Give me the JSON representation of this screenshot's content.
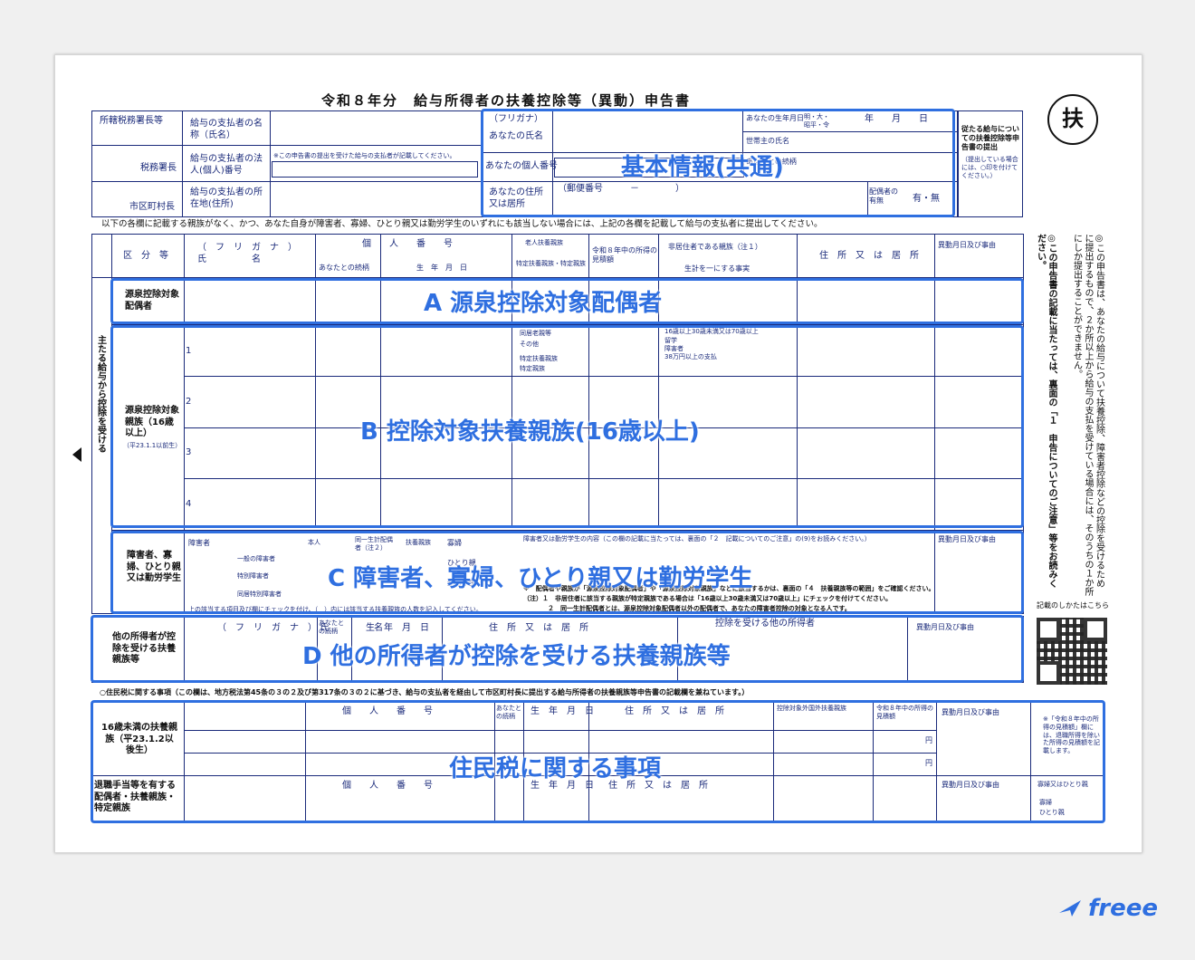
{
  "title": "令和８年分　給与所得者の扶養控除等（異動）申告書",
  "badge": "扶",
  "header": {
    "office_chief": "所轄税務署長等",
    "tax_office": "税務署長",
    "municipality": "市区町村長",
    "payer_name": "給与の支払者の名称（氏名）",
    "payer_number": "給与の支払者の法人(個人)番号",
    "payer_number_note": "※この申告書の提出を受けた給与の支払者が記載してください。",
    "payer_address": "給与の支払者の所在地(住所)",
    "furigana": "（フリガナ）",
    "your_name": "あなたの氏名",
    "your_number": "あなたの個人番号",
    "your_address": "あなたの住所又は居所",
    "postal": "（郵便番号　　　－　　　　）",
    "your_birthday": "あなたの生年月日",
    "era": "明・大・昭平・令",
    "ymd": "年　　月　　日",
    "household_head": "世帯主の氏名",
    "relation": "あなたとの続柄",
    "spouse": "配偶者の有無",
    "spouse_value": "有・無",
    "side_note": "従たる給与についての扶養控除等申告書の提出",
    "side_note_sub": "（提出している場合には、○印を付けてください。）"
  },
  "intro": "以下の各欄に記載する親族がなく、かつ、あなた自身が障害者、寡婦、ひとり親又は勤労学生のいずれにも該当しない場合には、上記の各欄を記載して給与の支払者に提出してください。",
  "columns": {
    "category": "区　分　等",
    "name": "（　フ　リ　ガ　ナ　）\n氏　　　　　名",
    "number": "個　　人　　番　　号",
    "relation": "あなたとの続柄",
    "birth": "生　年　月　日",
    "elderly": "老人扶養親族",
    "specific": "特定扶養親族・特定親族",
    "income": "令和８年中の所得の見積額",
    "nonresident": "非居住者である親族（注１）",
    "livelihood": "生計を一にする事実",
    "address": "住　所　又　は　居　所",
    "change": "異動月日及び事由"
  },
  "side_vertical": "主たる給与から控除を受ける",
  "sections": {
    "A": {
      "label": "源泉控除対象配偶者",
      "overlay": "A 源泉控除対象配偶者"
    },
    "B": {
      "label": "源泉控除対象親族（16歳以上）",
      "sub": "（平23.1.1以前生）",
      "overlay": "B 控除対象扶養親族(16歳以上)",
      "rows": [
        "1",
        "2",
        "3",
        "4"
      ],
      "checks": [
        "同居老親等",
        "その他",
        "特定扶養親族",
        "特定親族"
      ],
      "nr_checks": [
        "16歳以上30歳未満又は70歳以上",
        "留学",
        "障害者",
        "38万円以上の支払"
      ]
    },
    "C": {
      "label": "障害者、寡婦、ひとり親又は勤労学生",
      "overlay": "C 障害者、寡婦、ひとり親又は勤労学生",
      "items": [
        "障害者",
        "一般の障害者",
        "特別障害者",
        "同居特別障害者",
        "寡婦",
        "ひとり親",
        "勤労学生"
      ],
      "heads": [
        "本人",
        "同一生計配偶者（注２）",
        "扶養親族"
      ],
      "content": "障害者又は勤労学生の内容（この欄の記載に当たっては、裏面の「２　記載についてのご注意」の(9)をお読みください。）",
      "note1": "※　配偶者や親族が「源泉控除対象配偶者」や「源泉控除対象親族」などに該当するかは、裏面の「４　扶養親族等の範囲」をご確認ください。",
      "note2": "（注）１　非居住者に該当する親族が特定親族である場合は「16歳以上30歳未満又は70歳以上」にチェックを付けてください。",
      "note3": "２　同一生計配偶者とは、源泉控除対象配偶者以外の配偶者で、あなたの障害者控除の対象となる人です。",
      "footer": "上の該当する項目及び欄にチェックを付け、（　）内には該当する扶養親族の人数を記入してください。"
    },
    "D": {
      "label": "他の所得者が控除を受ける扶養親族等",
      "overlay": "D 他の所得者が控除を受ける扶養親族等",
      "other_earner": "控除を受ける他の所得者"
    },
    "E": {
      "heading": "○住民税に関する事項（この欄は、地方税法第45条の３の２及び第317条の３の２に基づき、給与の支払者を経由して市区町村長に提出する給与所得者の扶養親族等申告書の記載欄を兼ねています。）",
      "under16": "16歳未満の扶養親族（平23.1.2以後生）",
      "retire": "退職手当等を有する配偶者・扶養親族・特定親族",
      "overseas": "控除対象外国外扶養親族",
      "widow": "寡婦又はひとり親",
      "widow_opts": [
        "寡婦",
        "ひとり親"
      ],
      "yen": "円",
      "overlay": "住民税に関する事項",
      "note": "※「令和８年中の所得の見積額」欄には、退職所得を除いた所得の見積額を記載します。"
    }
  },
  "right_vertical": "◎この申告書は、あなたの給与について扶養控除、障害者控除などの控除を受けるために提出するもので、２か所以上から給与の支払を受けている場合には、そのうちの１か所にしか提出することができません。",
  "right_vertical2": "◎この申告書の記載に当たっては、裏面の「１　申告についてのご注意」等をお読みください。",
  "how_to": "記載のしかたはこちら",
  "overlay_basic": "基本情報(共通)",
  "logo": "freee",
  "colors": {
    "highlight": "#2f6fe0",
    "ink": "#1a2a7a"
  }
}
